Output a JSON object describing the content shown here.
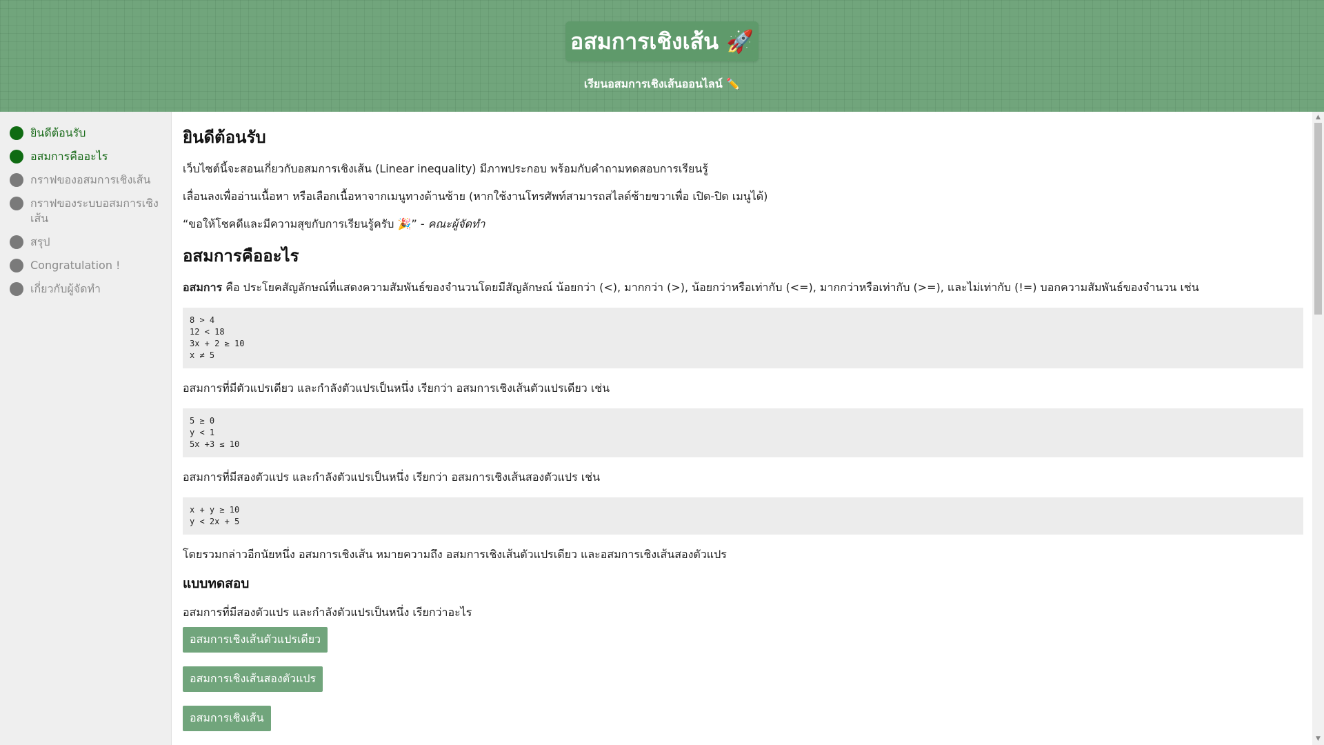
{
  "header": {
    "title": "อสมการเชิงเส้น 🚀",
    "subtitle": "เรียนอสมการเชิงเส้นออนไลน์ ✏️"
  },
  "sidebar": {
    "items": [
      {
        "label": "ยินดีต้อนรับ",
        "active": true
      },
      {
        "label": "อสมการคืออะไร",
        "active": true
      },
      {
        "label": "กราฟของอสมการเชิงเส้น",
        "active": false
      },
      {
        "label": "กราฟของระบบอสมการเชิงเส้น",
        "active": false
      },
      {
        "label": "สรุป",
        "active": false
      },
      {
        "label": "Congratulation !",
        "active": false
      },
      {
        "label": "เกี่ยวกับผู้จัดทำ",
        "active": false
      }
    ]
  },
  "main": {
    "welcome_heading": "ยินดีต้อนรับ",
    "welcome_p1": "เว็บไซต์นี้จะสอนเกี่ยวกับอสมการเชิงเส้น (Linear inequality) มีภาพประกอบ พร้อมกับคำถามทดสอบการเรียนรู้",
    "welcome_p2": "เลื่อนลงเพื่ออ่านเนื้อหา หรือเลือกเนื้อหาจากเมนูทางด้านซ้าย (หากใช้งานโทรศัพท์สามารถสไลด์ซ้ายขวาเพื่อ เปิด-ปิด เมนูได้)",
    "welcome_quote": "“ขอให้โชคดีและมีความสุขกับการเรียนรู้ครับ 🎉”",
    "welcome_quote_sep": " - ",
    "welcome_quote_author": "คณะผู้จัดทำ",
    "what_heading": "อสมการคืออะไร",
    "what_term": "อสมการ",
    "what_def": " คือ ประโยคสัญลักษณ์ที่แสดงความสัมพันธ์ของจำนวนโดยมีสัญลักษณ์ น้อยกว่า (<), มากกว่า (>), น้อยกว่าหรือเท่ากับ (<=), มากกว่าหรือเท่ากับ (>=), และไม่เท่ากับ (!=) บอกความสัมพันธ์ของจำนวน เช่น",
    "code1": [
      "8 > 4",
      "12 < 18",
      "3x + 2 ≥ 10",
      "x ≠ 5"
    ],
    "one_var_text": "อสมการที่มีตัวแปรเดียว และกำลังตัวแปรเป็นหนึ่ง เรียกว่า อสมการเชิงเส้นตัวแปรเดียว เช่น",
    "code2": [
      "5 ≥ 0",
      "y < 1",
      "5x +3 ≤ 10"
    ],
    "two_var_text": "อสมการที่มีสองตัวแปร และกำลังตัวแปรเป็นหนึ่ง เรียกว่า อสมการเชิงเส้นสองตัวแปร เช่น",
    "code3": [
      "x + y ≥ 10",
      "y < 2x + 5"
    ],
    "summary_text": "โดยรวมกล่าวอีกนัยหนึ่ง อสมการเชิงเส้น หมายความถึง อสมการเชิงเส้นตัวแปรเดียว และอสมการเชิงเส้นสองตัวแปร",
    "quiz_heading": "แบบทดสอบ",
    "quiz_question": "อสมการที่มีสองตัวแปร และกำลังตัวแปรเป็นหนึ่ง เรียกว่าอะไร",
    "quiz_options": [
      "อสมการเชิงเส้นตัวแปรเดียว",
      "อสมการเชิงเส้นสองตัวแปร",
      "อสมการเชิงเส้น"
    ]
  },
  "colors": {
    "header_bg": "#71a57c",
    "title_box_bg": "#5f9a6b",
    "active_nav": "#0f6b12",
    "inactive_nav": "#7a7a7a",
    "button_bg": "#71a57c",
    "code_bg": "#ececec"
  }
}
